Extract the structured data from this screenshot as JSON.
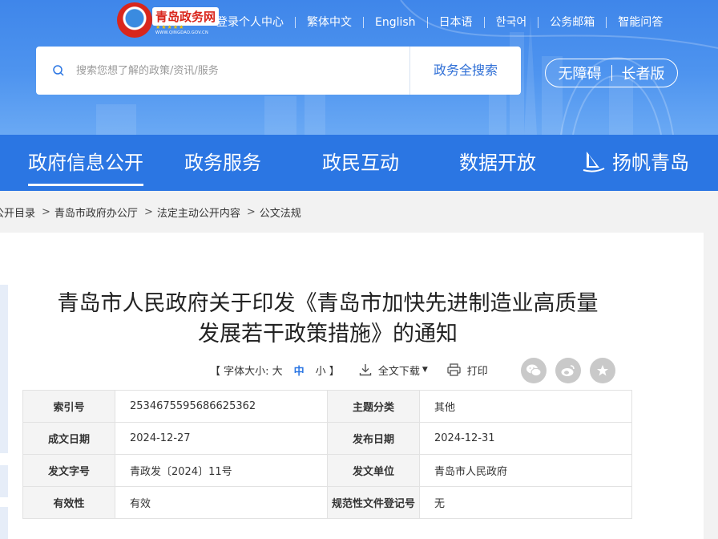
{
  "header": {
    "logo": {
      "title": "青岛政务网",
      "url_text": "WWW.QINGDAO.GOV.CN"
    },
    "top_links": [
      "登录个人中心",
      "繁体中文",
      "English",
      "日本语",
      "한국어",
      "公务邮箱",
      "智能问答"
    ],
    "search": {
      "placeholder": "搜索您想了解的政策/资讯/服务",
      "button": "政务全搜索"
    },
    "accessibility": {
      "barrier_free": "无障碍",
      "elder": "长者版"
    }
  },
  "nav": {
    "items": [
      "政府信息公开",
      "政务服务",
      "政民互动",
      "数据开放",
      "扬帆青岛"
    ],
    "active_index": 0
  },
  "breadcrumb": [
    "公开目录",
    "青岛市政府办公厅",
    "法定主动公开内容",
    "公文法规"
  ],
  "document": {
    "title_line1": "青岛市人民政府关于印发《青岛市加快先进制造业高质量",
    "title_line2": "发展若干政策措施》的通知",
    "tools": {
      "font_size_label": "【 字体大小: 大",
      "font_mid": "中",
      "font_small": "小 】",
      "download": "全文下载",
      "print": "打印"
    },
    "share_icons": [
      "wechat-icon",
      "weibo-icon",
      "star-icon"
    ],
    "meta": [
      {
        "k1": "索引号",
        "v1": "2534675595686625362",
        "k2": "主题分类",
        "v2": "其他"
      },
      {
        "k1": "成文日期",
        "v1": "2024-12-27",
        "k2": "发布日期",
        "v2": "2024-12-31"
      },
      {
        "k1": "发文字号",
        "v1": "青政发〔2024〕11号",
        "k2": "发文单位",
        "v2": "青岛市人民政府"
      },
      {
        "k1": "有效性",
        "v1": "有效",
        "k2": "规范性文件登记号",
        "v2": "无"
      }
    ]
  },
  "colors": {
    "nav_bg": "#2b76e3",
    "hero_bg": "#4e94ef",
    "accent": "#2b76e3",
    "logo_red": "#d9261c"
  }
}
